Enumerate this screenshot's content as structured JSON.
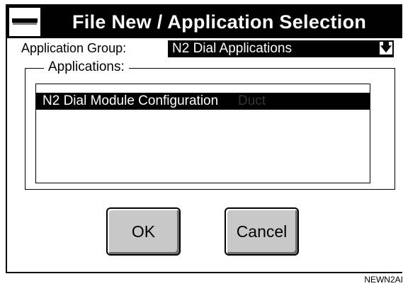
{
  "window": {
    "title": "File New / Application Selection",
    "system_menu_icon": "system-menu-icon"
  },
  "application_group": {
    "label": "Application Group:",
    "selected": "N2 Dial Applications",
    "dropdown_icon": "arrow-down-icon"
  },
  "applications": {
    "group_label": "Applications:",
    "items": [
      {
        "label": "N2 Dial Module Configuration",
        "overlay_text": "Duct",
        "selected": true
      }
    ]
  },
  "buttons": {
    "ok_label": "OK",
    "cancel_label": "Cancel"
  },
  "figure_caption": "NEWN2AI"
}
